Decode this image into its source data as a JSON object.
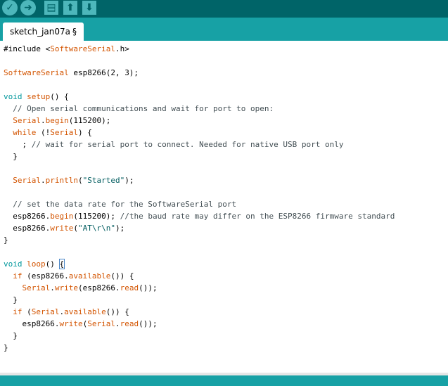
{
  "toolbar": {
    "buttons": [
      {
        "name": "verify",
        "icon": "checkmark-icon",
        "glyph": "✓"
      },
      {
        "name": "upload",
        "icon": "arrow-right-icon",
        "glyph": "➜"
      },
      {
        "name": "new",
        "icon": "new-file-icon",
        "glyph": "▤"
      },
      {
        "name": "open",
        "icon": "arrow-up-icon",
        "glyph": "⬆"
      },
      {
        "name": "save",
        "icon": "arrow-down-icon",
        "glyph": "⬇"
      }
    ]
  },
  "tabs": [
    {
      "label": "sketch_jan07a",
      "modified_marker": "§",
      "active": true
    }
  ],
  "editor": {
    "lines": [
      [
        {
          "t": "#include ",
          "c": "k-lit"
        },
        {
          "t": "<",
          "c": "k-lit"
        },
        {
          "t": "SoftwareSerial",
          "c": "k-orange"
        },
        {
          "t": ".h>",
          "c": "k-lit"
        }
      ],
      [],
      [
        {
          "t": "SoftwareSerial",
          "c": "k-orange"
        },
        {
          "t": " esp8266(2, 3);",
          "c": "k-lit"
        }
      ],
      [],
      [
        {
          "t": "void",
          "c": "k-type"
        },
        {
          "t": " ",
          "c": "k-lit"
        },
        {
          "t": "setup",
          "c": "k-func"
        },
        {
          "t": "() {",
          "c": "k-lit"
        }
      ],
      [
        {
          "t": "  // Open serial communications and wait for port to open:",
          "c": "k-comment"
        }
      ],
      [
        {
          "t": "  ",
          "c": "k-lit"
        },
        {
          "t": "Serial",
          "c": "k-orange"
        },
        {
          "t": ".",
          "c": "k-lit"
        },
        {
          "t": "begin",
          "c": "k-func"
        },
        {
          "t": "(115200);",
          "c": "k-lit"
        }
      ],
      [
        {
          "t": "  ",
          "c": "k-lit"
        },
        {
          "t": "while",
          "c": "k-func"
        },
        {
          "t": " (!",
          "c": "k-lit"
        },
        {
          "t": "Serial",
          "c": "k-orange"
        },
        {
          "t": ") {",
          "c": "k-lit"
        }
      ],
      [
        {
          "t": "    ; ",
          "c": "k-lit"
        },
        {
          "t": "// wait for serial port to connect. Needed for native USB port only",
          "c": "k-comment"
        }
      ],
      [
        {
          "t": "  }",
          "c": "k-lit"
        }
      ],
      [],
      [
        {
          "t": "  ",
          "c": "k-lit"
        },
        {
          "t": "Serial",
          "c": "k-orange"
        },
        {
          "t": ".",
          "c": "k-lit"
        },
        {
          "t": "println",
          "c": "k-func"
        },
        {
          "t": "(",
          "c": "k-lit"
        },
        {
          "t": "\"Started\"",
          "c": "k-str"
        },
        {
          "t": ");",
          "c": "k-lit"
        }
      ],
      [],
      [
        {
          "t": "  // set the data rate for the SoftwareSerial port",
          "c": "k-comment"
        }
      ],
      [
        {
          "t": "  esp8266.",
          "c": "k-lit"
        },
        {
          "t": "begin",
          "c": "k-func"
        },
        {
          "t": "(115200); ",
          "c": "k-lit"
        },
        {
          "t": "//the baud rate may differ on the ESP8266 firmware standard",
          "c": "k-comment"
        }
      ],
      [
        {
          "t": "  esp8266.",
          "c": "k-lit"
        },
        {
          "t": "write",
          "c": "k-func"
        },
        {
          "t": "(",
          "c": "k-lit"
        },
        {
          "t": "\"AT\\r\\n\"",
          "c": "k-str"
        },
        {
          "t": ");",
          "c": "k-lit"
        }
      ],
      [
        {
          "t": "}",
          "c": "k-lit"
        }
      ],
      [],
      [
        {
          "t": "void",
          "c": "k-type"
        },
        {
          "t": " ",
          "c": "k-lit"
        },
        {
          "t": "loop",
          "c": "k-func"
        },
        {
          "t": "() ",
          "c": "k-lit"
        },
        {
          "t": "{",
          "c": "k-bracket"
        }
      ],
      [
        {
          "t": "  ",
          "c": "k-lit"
        },
        {
          "t": "if",
          "c": "k-func"
        },
        {
          "t": " (esp8266.",
          "c": "k-lit"
        },
        {
          "t": "available",
          "c": "k-func"
        },
        {
          "t": "()) {",
          "c": "k-lit"
        }
      ],
      [
        {
          "t": "    ",
          "c": "k-lit"
        },
        {
          "t": "Serial",
          "c": "k-orange"
        },
        {
          "t": ".",
          "c": "k-lit"
        },
        {
          "t": "write",
          "c": "k-func"
        },
        {
          "t": "(esp8266.",
          "c": "k-lit"
        },
        {
          "t": "read",
          "c": "k-func"
        },
        {
          "t": "());",
          "c": "k-lit"
        }
      ],
      [
        {
          "t": "  }",
          "c": "k-lit"
        }
      ],
      [
        {
          "t": "  ",
          "c": "k-lit"
        },
        {
          "t": "if",
          "c": "k-func"
        },
        {
          "t": " (",
          "c": "k-lit"
        },
        {
          "t": "Serial",
          "c": "k-orange"
        },
        {
          "t": ".",
          "c": "k-lit"
        },
        {
          "t": "available",
          "c": "k-func"
        },
        {
          "t": "()) {",
          "c": "k-lit"
        }
      ],
      [
        {
          "t": "    esp8266.",
          "c": "k-lit"
        },
        {
          "t": "write",
          "c": "k-func"
        },
        {
          "t": "(",
          "c": "k-lit"
        },
        {
          "t": "Serial",
          "c": "k-orange"
        },
        {
          "t": ".",
          "c": "k-lit"
        },
        {
          "t": "read",
          "c": "k-func"
        },
        {
          "t": "());",
          "c": "k-lit"
        }
      ],
      [
        {
          "t": "  }",
          "c": "k-lit"
        }
      ],
      [
        {
          "t": "}",
          "c": "k-lit"
        }
      ]
    ]
  },
  "colors": {
    "toolbar_bg": "#006468",
    "tabstrip_bg": "#17a1a5",
    "button_bg": "#4db7bb",
    "keyword_orange": "#d35400",
    "type_teal": "#00979c",
    "comment_gray": "#434f54"
  }
}
